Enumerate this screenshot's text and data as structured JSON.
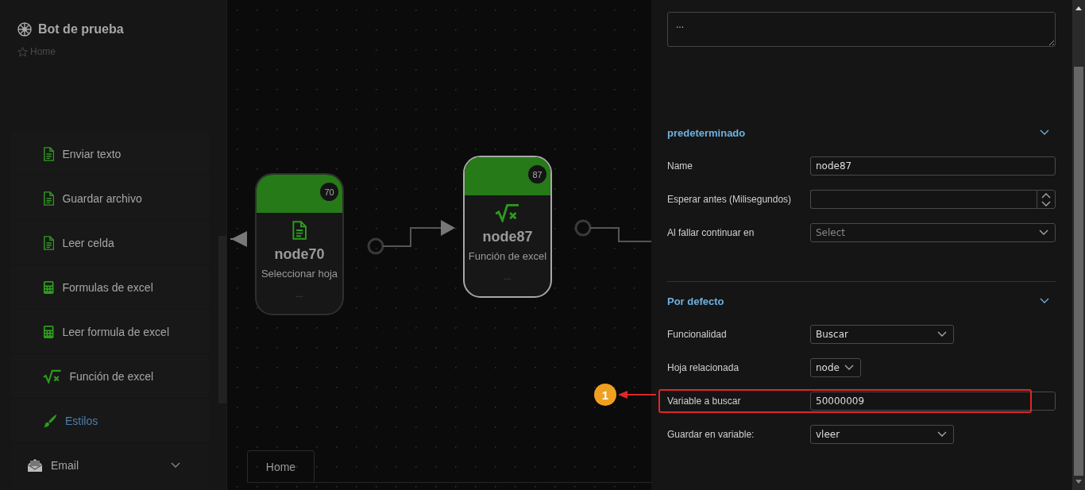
{
  "sidebar": {
    "title": "Bot de prueba",
    "breadcrumb": "Home",
    "items": [
      {
        "label": "Enviar texto",
        "kind": "document",
        "selected": false
      },
      {
        "label": "Guardar archivo",
        "kind": "document",
        "selected": false
      },
      {
        "label": "Leer celda",
        "kind": "document",
        "selected": false
      },
      {
        "label": "Formulas de excel",
        "kind": "calculator",
        "selected": false
      },
      {
        "label": "Leer formula de excel",
        "kind": "calculator",
        "selected": false
      },
      {
        "label": "Función de excel",
        "kind": "formula",
        "selected": false
      },
      {
        "label": "Estilos",
        "kind": "brush",
        "selected": true
      }
    ],
    "groups": [
      {
        "label": "Email",
        "expanded": false
      }
    ]
  },
  "canvas": {
    "nodes": [
      {
        "badge": "70",
        "title": "node70",
        "subtitle": "Seleccionar hoja",
        "footer": "...",
        "kind": "document",
        "selected": false
      },
      {
        "badge": "87",
        "title": "node87",
        "subtitle": "Función de excel",
        "footer": "...",
        "kind": "formula",
        "selected": true
      }
    ],
    "tabs": [
      {
        "label": "Home",
        "selected": true
      }
    ]
  },
  "panel": {
    "description": "...",
    "sections": [
      {
        "title": "predeterminado",
        "expanded": true,
        "fields": [
          {
            "label": "Name",
            "kind": "text",
            "value": "node87"
          },
          {
            "label": "Esperar antes (Milisegundos)",
            "kind": "number"
          },
          {
            "label": "Al fallar continuar en",
            "kind": "select",
            "placeholder": "Select"
          }
        ]
      },
      {
        "title": "Por defecto",
        "expanded": true,
        "fields": [
          {
            "label": "Funcionalidad",
            "kind": "dropdown",
            "value": "Buscar"
          },
          {
            "label": "Hoja relacionada",
            "kind": "compact",
            "value": "node"
          },
          {
            "label": "Variable a buscar",
            "kind": "text",
            "value": "50000009",
            "highlighted": true
          },
          {
            "label": "Guardar en variable:",
            "kind": "dropdown",
            "value": "vleer"
          }
        ]
      }
    ]
  },
  "callout": {
    "label": "1"
  }
}
